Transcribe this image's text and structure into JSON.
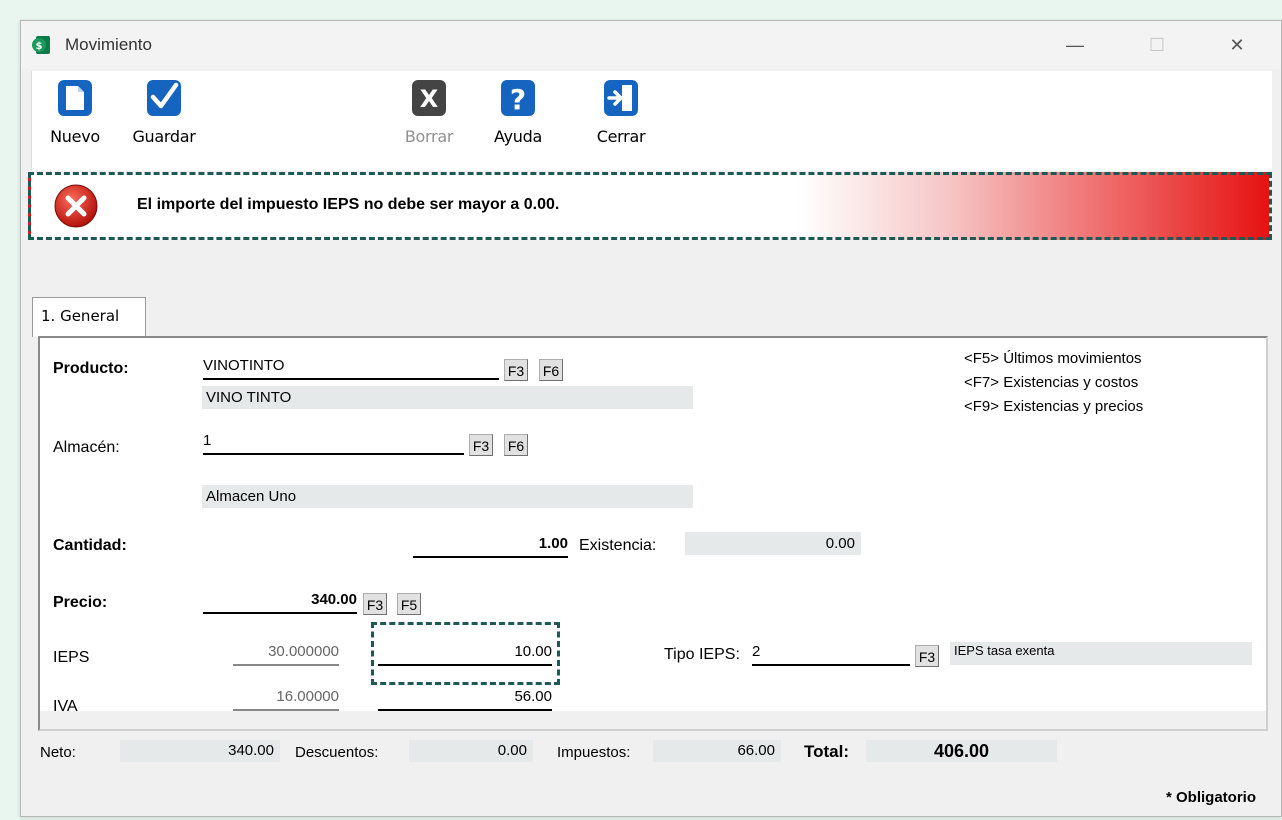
{
  "window": {
    "title": "Movimiento",
    "controls": {
      "minimize": "—",
      "maximize": "☐",
      "close": "✕"
    }
  },
  "toolbar": {
    "nuevo_label": "Nuevo",
    "guardar_label": "Guardar",
    "borrar_label": "Borrar",
    "ayuda_label": "Ayuda",
    "cerrar_label": "Cerrar"
  },
  "alert": {
    "message": "El importe del impuesto IEPS no debe ser mayor a 0.00."
  },
  "tabs": [
    {
      "label": "1. General"
    }
  ],
  "form": {
    "producto": {
      "label": "Producto:",
      "code": "VINOTINTO",
      "desc": "VINO TINTO",
      "f3": "F3",
      "f6": "F6"
    },
    "almacen": {
      "label": "Almacén:",
      "code": "1",
      "desc": "Almacen Uno",
      "f3": "F3",
      "f6": "F6"
    },
    "cantidad": {
      "label": "Cantidad:",
      "value": "1.00",
      "existencia_label": "Existencia:",
      "existencia_value": "0.00"
    },
    "precio": {
      "label": "Precio:",
      "value": "340.00",
      "f3": "F3",
      "f5": "F5"
    },
    "ieps": {
      "label": "IEPS",
      "rate": "30.000000",
      "amount": "10.00",
      "tipo_label": "Tipo IEPS:",
      "tipo_value": "2",
      "f3": "F3",
      "tipo_desc": "IEPS tasa exenta"
    },
    "iva": {
      "label": "IVA",
      "rate": "16.00000",
      "amount": "56.00"
    }
  },
  "hints": [
    "<F5> Últimos movimientos",
    "<F7> Existencias y costos",
    "<F9> Existencias y precios"
  ],
  "summary": {
    "neto_label": "Neto:",
    "neto": "340.00",
    "descuentos_label": "Descuentos:",
    "descuentos": "0.00",
    "impuestos_label": "Impuestos:",
    "impuestos": "66.00",
    "total_label": "Total:",
    "total": "406.00"
  },
  "footer": {
    "obligatorio": "* Obligatorio"
  },
  "colors": {
    "accent": "#1565c0",
    "highlight_border": "#1e5a55",
    "error_red": "#e61212"
  },
  "icons": [
    "app-icon",
    "new-document-icon",
    "checkmark-icon",
    "delete-icon",
    "help-icon",
    "exit-door-icon",
    "error-icon"
  ]
}
